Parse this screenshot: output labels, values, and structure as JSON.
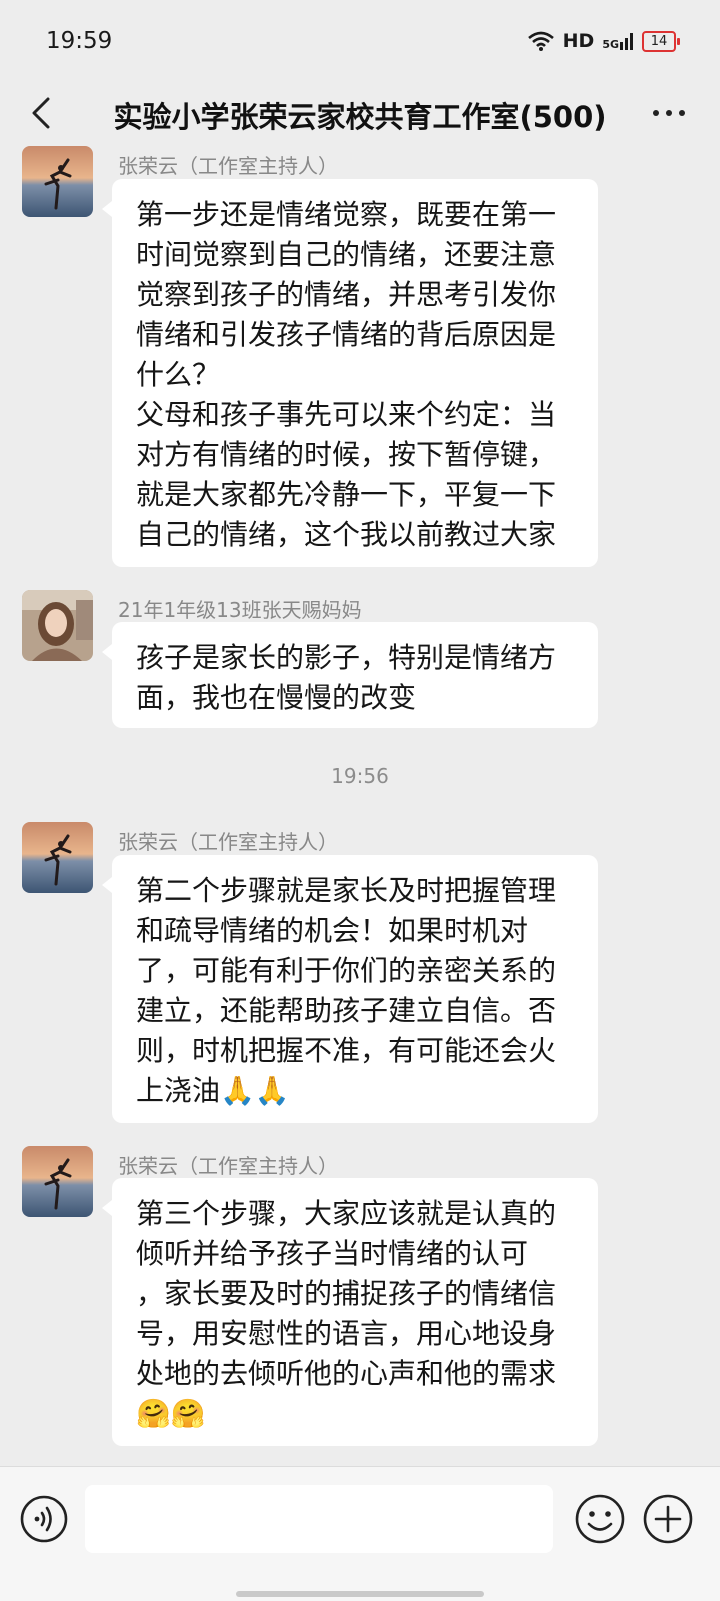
{
  "status_bar": {
    "time": "19:59",
    "hd": "HD",
    "network": "5G",
    "battery": "14"
  },
  "header": {
    "title": "实验小学张荣云家校共育工作室(500)"
  },
  "messages": [
    {
      "sender": "张荣云（工作室主持人）",
      "lines": [
        "第一步还是情绪觉察，既要在第一",
        "时间觉察到自己的情绪，还要注意",
        "觉察到孩子的情绪，并思考引发你",
        "情绪和引发孩子情绪的背后原因是",
        "什么？",
        "父母和孩子事先可以来个约定：当",
        "对方有情绪的时候，按下暂停键，",
        "就是大家都先冷静一下，平复一下",
        "自己的情绪，这个我以前教过大家"
      ]
    },
    {
      "sender": "21年1年级13班张天赐妈妈",
      "lines": [
        "孩子是家长的影子，特别是情绪方",
        "面，我也在慢慢的改变"
      ]
    },
    {
      "sender": "张荣云（工作室主持人）",
      "lines": [
        "第二个步骤就是家长及时把握管理",
        "和疏导情绪的机会！如果时机对",
        "了，可能有利于你们的亲密关系的",
        "建立，还能帮助孩子建立自信。否",
        "则，时机把握不准，有可能还会火",
        "上浇油🙏🙏"
      ]
    },
    {
      "sender": "张荣云（工作室主持人）",
      "lines": [
        "第三个步骤，大家应该就是认真的",
        "倾听并给予孩子当时情绪的认可",
        "，家长要及时的捕捉孩子的情绪信",
        "号，用安慰性的语言，用心地设身",
        "处地的去倾听他的心声和他的需求",
        "🤗🤗"
      ]
    }
  ],
  "timestamp": "19:56",
  "icons": {
    "back": "chevron-left-icon",
    "more": "more-dots-icon",
    "voice": "voice-icon",
    "emoji": "emoji-icon",
    "plus": "plus-icon"
  }
}
